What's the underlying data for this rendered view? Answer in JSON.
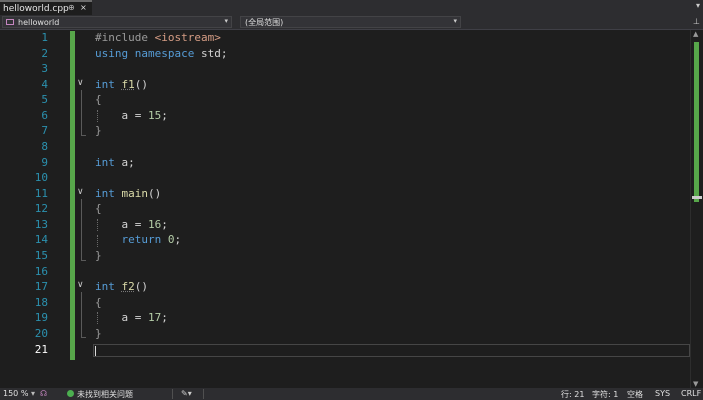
{
  "tab": {
    "title": "helloworld.cpp",
    "pin": "⊕",
    "close": "×",
    "overflow": "▾"
  },
  "nav": {
    "project": "helloworld",
    "scope": "(全局范围)",
    "dropdown": "▾"
  },
  "editor": {
    "lines": [
      {
        "n": "1"
      },
      {
        "n": "2"
      },
      {
        "n": "3"
      },
      {
        "n": "4"
      },
      {
        "n": "5"
      },
      {
        "n": "6"
      },
      {
        "n": "7"
      },
      {
        "n": "8"
      },
      {
        "n": "9"
      },
      {
        "n": "10"
      },
      {
        "n": "11"
      },
      {
        "n": "12"
      },
      {
        "n": "13"
      },
      {
        "n": "14"
      },
      {
        "n": "15"
      },
      {
        "n": "16"
      },
      {
        "n": "17"
      },
      {
        "n": "18"
      },
      {
        "n": "19"
      },
      {
        "n": "20"
      },
      {
        "n": "21"
      }
    ],
    "code": {
      "l1_directive": "#include ",
      "l1_header": "<iostream>",
      "l2_using": "using",
      "l2_namespace": "namespace",
      "l2_rest": " std;",
      "l4_type": "int",
      "l4_name": "f1",
      "l4_parens": "()",
      "l5": "{",
      "l6_var": "a",
      "l6_op": " = ",
      "l6_num": "15",
      "l6_semi": ";",
      "l7": "}",
      "l9_type": "int",
      "l9_rest": " a;",
      "l11_type": "int",
      "l11_name": "main",
      "l11_parens": "()",
      "l12": "{",
      "l13_var": "a",
      "l13_op": " = ",
      "l13_num": "16",
      "l13_semi": ";",
      "l14_kw": "return",
      "l14_num": "0",
      "l14_semi": ";",
      "l15": "}",
      "l17_type": "int",
      "l17_name": "f2",
      "l17_parens": "()",
      "l18": "{",
      "l19_var": "a",
      "l19_op": " = ",
      "l19_num": "17",
      "l19_semi": ";",
      "l20": "}",
      "fold_glyph": "∨"
    }
  },
  "status": {
    "zoom": "150 %",
    "issues": "未找到相关问题",
    "row": "行: 21",
    "col": "字符: 1",
    "spaces": "空格",
    "encoding": "SYS",
    "eol": "CRLF"
  },
  "colors": {
    "accent_green": "#57a64a",
    "keyword": "#569cd6",
    "function": "#dcdcaa",
    "number": "#b5cea8",
    "line_number": "#2b91af"
  }
}
